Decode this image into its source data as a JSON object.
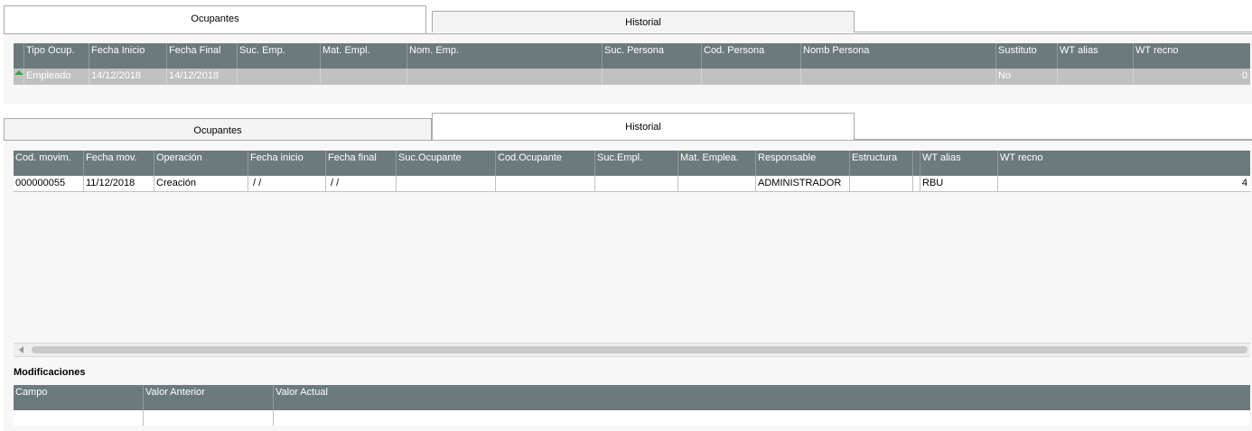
{
  "top_tabs": {
    "ocupantes": "Ocupantes",
    "historial": "Historial"
  },
  "occupants_grid": {
    "columns": [
      "Tipo Ocup.",
      "Fecha Inicio",
      "Fecha Final",
      "Suc. Emp.",
      "Mat. Empl.",
      "Nom. Emp.",
      "Suc. Persona",
      "Cod. Persona",
      "Nomb Persona",
      "Sustituto",
      "WT alias",
      "WT recno"
    ],
    "rows": [
      [
        "Empleado",
        "14/12/2018",
        "14/12/2018",
        "",
        "",
        "",
        "",
        "",
        "",
        "No",
        "",
        "0"
      ]
    ]
  },
  "bottom_tabs": {
    "ocupantes": "Ocupantes",
    "historial": "Historial"
  },
  "history_grid": {
    "columns": [
      "Cod. movim.",
      "Fecha mov.",
      "Operación",
      "Fecha inicio",
      "Fecha final",
      "Suc.Ocupante",
      "Cod.Ocupante",
      "Suc.Empl.",
      "Mat. Emplea.",
      "Responsable",
      "Estructura",
      "",
      "WT alias",
      "WT recno"
    ],
    "rows": [
      [
        "000000055",
        "11/12/2018",
        "Creación",
        " / /",
        " / /",
        "",
        "",
        "",
        "",
        "ADMINISTRADOR",
        "",
        "",
        "RBU",
        "4"
      ]
    ]
  },
  "modifications": {
    "title": "Modificaciones",
    "columns": [
      "Campo",
      "Valor Anterior",
      "Valor Actual"
    ],
    "rows": [
      [
        "",
        "",
        ""
      ]
    ]
  },
  "colors": {
    "header_bg": "#6b7a7d",
    "selected_row_bg": "#c0c0c0",
    "panel_bg": "#f7f7f7"
  }
}
